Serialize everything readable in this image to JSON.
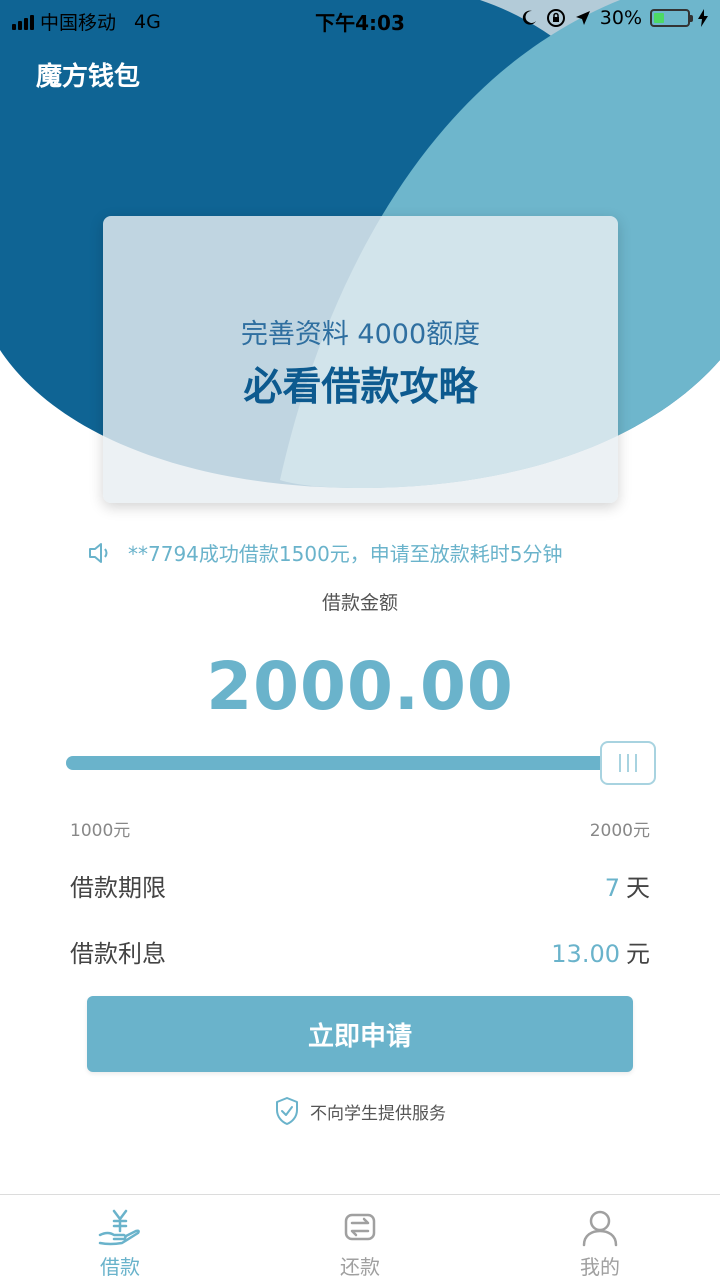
{
  "status_bar": {
    "carrier": "中国移动",
    "network": "4G",
    "time": "下午4:03",
    "battery": "30%",
    "battery_level": 0.3
  },
  "app": {
    "title": "魔方钱包"
  },
  "colors": {
    "hero_dark": "#0f6494",
    "hero_light": "#6eb6cc",
    "accent": "#6ab3cb"
  },
  "promo": {
    "line1": "完善资料  4000额度",
    "line2": "必看借款攻略"
  },
  "notice": {
    "icon": "speaker-icon",
    "text": "**7794成功借款1500元，申请至放款耗时5分钟"
  },
  "loan": {
    "amount_label": "借款金额",
    "amount": "2000.00",
    "slider_min_label": "1000元",
    "slider_max_label": "2000元",
    "slider_value": 1.0,
    "term_label": "借款期限",
    "term_value": "7",
    "term_unit": "天",
    "interest_label": "借款利息",
    "interest_value": "13.00",
    "interest_unit": "元"
  },
  "apply_button": "立即申请",
  "disclaimer": {
    "icon": "shield-check-icon",
    "text": "不向学生提供服务"
  },
  "tabs": [
    {
      "label": "借款",
      "icon": "yen-hand-icon",
      "active": true
    },
    {
      "label": "还款",
      "icon": "repay-cycle-icon",
      "active": false
    },
    {
      "label": "我的",
      "icon": "user-icon",
      "active": false
    }
  ]
}
